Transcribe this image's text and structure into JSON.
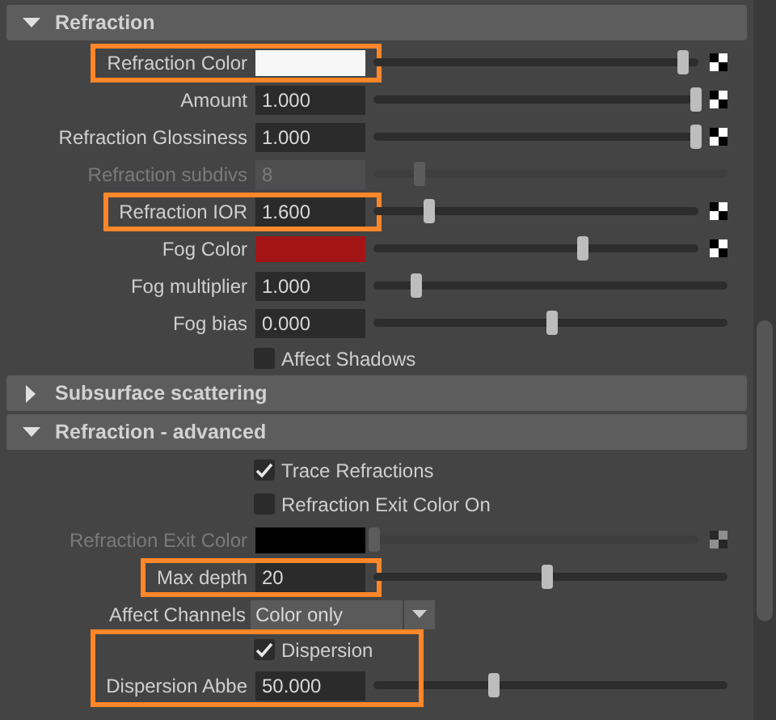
{
  "sections": [
    {
      "title": "Refraction",
      "expanded": true,
      "rows": [
        {
          "kind": "color",
          "label": "Refraction Color",
          "color": "#f7f7f7",
          "level": 0.95,
          "map": true,
          "disabled": false,
          "highlighted": true
        },
        {
          "kind": "number",
          "label": "Amount",
          "value": "1.000",
          "level": 0.99,
          "map": true,
          "disabled": false,
          "highlighted": false
        },
        {
          "kind": "number",
          "label": "Refraction Glossiness",
          "value": "1.000",
          "level": 0.99,
          "map": true,
          "disabled": false,
          "highlighted": false
        },
        {
          "kind": "number",
          "label": "Refraction subdivs",
          "value": "8",
          "level": 0.13,
          "map": false,
          "disabled": true,
          "highlighted": false
        },
        {
          "kind": "number",
          "label": "Refraction IOR",
          "value": "1.600",
          "level": 0.17,
          "map": true,
          "disabled": false,
          "highlighted": true
        },
        {
          "kind": "color",
          "label": "Fog Color",
          "color": "#a31515",
          "level": 0.64,
          "map": true,
          "disabled": false,
          "highlighted": false
        },
        {
          "kind": "number",
          "label": "Fog multiplier",
          "value": "1.000",
          "level": 0.12,
          "map": false,
          "disabled": false,
          "highlighted": false
        },
        {
          "kind": "number",
          "label": "Fog bias",
          "value": "0.000",
          "level": 0.5,
          "map": false,
          "disabled": false,
          "highlighted": false
        },
        {
          "kind": "checkbox",
          "label": "Affect Shadows",
          "checked": false
        }
      ]
    },
    {
      "title": "Subsurface scattering",
      "expanded": false
    },
    {
      "title": "Refraction - advanced",
      "expanded": true,
      "rows": [
        {
          "kind": "checkbox",
          "label": "Trace Refractions",
          "checked": true
        },
        {
          "kind": "checkbox",
          "label": "Refraction Exit Color On",
          "checked": false
        },
        {
          "kind": "color",
          "label": "Refraction Exit Color",
          "color": "#000000",
          "level": 0.0,
          "map": true,
          "disabled": true,
          "highlighted": false
        },
        {
          "kind": "number",
          "label": "Max depth",
          "value": "20",
          "level": 0.49,
          "map": false,
          "disabled": false,
          "highlighted": true
        },
        {
          "kind": "dropdown",
          "label": "Affect Channels",
          "value": "Color only"
        },
        {
          "kind": "group",
          "highlighted": true,
          "rows": [
            {
              "kind": "checkbox",
              "label": "Dispersion",
              "checked": true
            },
            {
              "kind": "number",
              "label": "Dispersion Abbe",
              "value": "50.000",
              "level": 0.34,
              "map": false,
              "disabled": false,
              "highlighted": false
            }
          ]
        }
      ]
    }
  ]
}
